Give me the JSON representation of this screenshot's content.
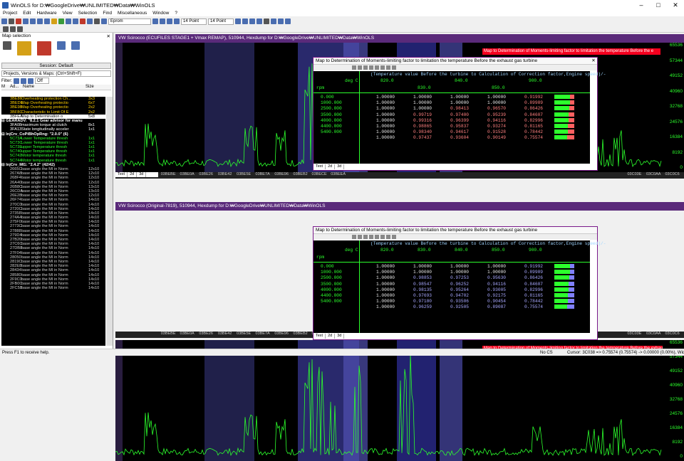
{
  "window": {
    "title": "WinOLS for D:₩GoogleDrive₩UNLIMITED₩Data₩WinOLS"
  },
  "menu": [
    "Project",
    "Edit",
    "Hardware",
    "View",
    "Selection",
    "Find",
    "Miscellaneous",
    "Window",
    "?"
  ],
  "toolbar": {
    "eprom": "Eprom",
    "font1": "14 Point",
    "font2": "14 Point"
  },
  "panel": {
    "title": "Map selection",
    "session": "Session: Default",
    "project_field": "Projects, Versions & Maps: (Ctrl+Shift+F)",
    "filter_label": "Filter:",
    "filter_value": "Off",
    "col_m": "M",
    "col_addr": "Ad...",
    "col_name": "Name",
    "col_size": "Size"
  },
  "maplist": [
    {
      "id": "3BE86",
      "name": "Overheating protection Ch...",
      "size": "3x3",
      "style": "c-yel"
    },
    {
      "id": "3BEDE",
      "name": "Map Overheating protectio",
      "size": "6x7",
      "style": "c-yel"
    },
    {
      "id": "3BE98",
      "name": "Map Overheating protectio",
      "size": "2x2",
      "style": "c-yel"
    },
    {
      "id": "3BF8C",
      "name": "Characteristic to Limit Of E",
      "size": "2x2",
      "style": "c-yel"
    },
    {
      "id": "3BFEA",
      "name": "Map to Determination o",
      "size": "5x8",
      "style": "sel"
    },
    {
      "id": "GEARADV",
      "name": "\"8.2.1     Gear advisor for manu",
      "size": "",
      "style": "grp"
    },
    {
      "id": "3FA08",
      "name": "maximum torque at clutch",
      "size": "8x1",
      "style": "c-wht"
    },
    {
      "id": "3FA13",
      "name": "State longitudinally acceler",
      "size": "1x1",
      "style": "c-wht"
    },
    {
      "id": "InjCrv_CoPiBhOpRng",
      "name": "\"2.0.0\" (6)",
      "size": "",
      "style": "grp"
    },
    {
      "id": "5C73A",
      "name": "Lower Temperature thresh",
      "size": "1x1",
      "style": "c-grn"
    },
    {
      "id": "5C73C",
      "name": "Lower Temperature thresh",
      "size": "1x1",
      "style": "c-grn"
    },
    {
      "id": "5C73E",
      "name": "upper Temperature thresh",
      "size": "1x1",
      "style": "c-grn"
    },
    {
      "id": "5C740",
      "name": "upper Temperature thresh",
      "size": "1x1",
      "style": "c-grn"
    },
    {
      "id": "5C742",
      "name": "Motor temperature thresh",
      "size": "1x1",
      "style": "c-grn"
    },
    {
      "id": "5C744",
      "name": "Motor temperature thresh",
      "size": "1x1",
      "style": "c-grn"
    },
    {
      "id": "InjCrv_MI1",
      "name": "\"2.4.2\" (42/42)",
      "size": "",
      "style": "grp"
    },
    {
      "id": "2665C",
      "name": "base angle the MI in Norm",
      "size": "12x10",
      "style": ""
    },
    {
      "id": "267A8",
      "name": "base angle the MI in Norm",
      "size": "12x10",
      "style": ""
    },
    {
      "id": "268F4",
      "name": "base angle the MI in Norm",
      "size": "12x10",
      "style": ""
    },
    {
      "id": "26A40",
      "name": "base angle the MI in Norm",
      "size": "12x10",
      "style": ""
    },
    {
      "id": "26B8C",
      "name": "base angle the MI in Norm",
      "size": "13x10",
      "style": ""
    },
    {
      "id": "26CDA",
      "name": "base angle the MI in Norm",
      "size": "13x10",
      "style": ""
    },
    {
      "id": "26E28",
      "name": "base angle the MI in Norm",
      "size": "12x10",
      "style": ""
    },
    {
      "id": "26F74",
      "name": "base angle the MI in Norm",
      "size": "14x10",
      "style": ""
    },
    {
      "id": "270C0",
      "name": "base angle the MI in Norm",
      "size": "14x10",
      "style": ""
    },
    {
      "id": "2720C",
      "name": "base angle the MI in Norm",
      "size": "14x10",
      "style": ""
    },
    {
      "id": "27358",
      "name": "base angle the MI in Norm",
      "size": "14x10",
      "style": ""
    },
    {
      "id": "274A4",
      "name": "base angle the MI in Norm",
      "size": "14x10",
      "style": ""
    },
    {
      "id": "275F0",
      "name": "base angle the MI in Norm",
      "size": "14x10",
      "style": ""
    },
    {
      "id": "2773C",
      "name": "base angle the MI in Norm",
      "size": "14x10",
      "style": ""
    },
    {
      "id": "27888",
      "name": "base angle the MI in Norm",
      "size": "14x10",
      "style": ""
    },
    {
      "id": "279D4",
      "name": "base angle the MI in Norm",
      "size": "14x10",
      "style": ""
    },
    {
      "id": "27B20",
      "name": "base angle the MI in Norm",
      "size": "14x10",
      "style": ""
    },
    {
      "id": "27C6C",
      "name": "base angle the MI in Norm",
      "size": "14x10",
      "style": ""
    },
    {
      "id": "27DB8",
      "name": "base angle the MI in Norm",
      "size": "14x10",
      "style": ""
    },
    {
      "id": "27F04",
      "name": "base angle the MI in Norm",
      "size": "14x10",
      "style": ""
    },
    {
      "id": "28050",
      "name": "base angle the MI in Norm",
      "size": "14x10",
      "style": ""
    },
    {
      "id": "2819C",
      "name": "base angle the MI in Norm",
      "size": "14x10",
      "style": ""
    },
    {
      "id": "282E8",
      "name": "base angle the MI in Norm",
      "size": "14x10",
      "style": ""
    },
    {
      "id": "28434",
      "name": "base angle the MI in Norm",
      "size": "14x10",
      "style": ""
    },
    {
      "id": "28580",
      "name": "base angle the MI in Norm",
      "size": "14x10",
      "style": ""
    },
    {
      "id": "2F9C0",
      "name": "base angle the MI in Norm",
      "size": "14x10",
      "style": ""
    },
    {
      "id": "2FB0C",
      "name": "base angle the MI in Norm",
      "size": "14x10",
      "style": ""
    },
    {
      "id": "2FC58",
      "name": "base angle the MI in Norm",
      "size": "14x10",
      "style": ""
    }
  ],
  "pane_top": {
    "title": "VW Scirocco (ECUFILES STAGE1 + Vmax REMAP), 510944, Hexdump for D:₩GoogleDrive₩UNLIMITED₩Data₩WinOLS",
    "banner": "Map to Determination of Moments-limiting factor to limitation the temperature Before the e",
    "addresses": [
      "03BEBE",
      "03BE0A",
      "03BE26",
      "03BE42",
      "03BE5E",
      "03BE7A",
      "03BE96",
      "03BEB2",
      "03BECE",
      "03BEEA"
    ],
    "right_addresses": [
      "03C03E",
      "03C0AA",
      "03C0C6"
    ],
    "right_axis": [
      "65536",
      "57344",
      "49152",
      "40960",
      "32768",
      "24576",
      "16384",
      "8192",
      "0"
    ],
    "tabs": [
      "Text",
      "2d",
      "3d"
    ]
  },
  "pane_bottom": {
    "title": "VW Scirocco (Original-7819), 510944, Hexdump for D:₩GoogleDrive₩UNLIMITED₩Data₩WinOLS",
    "banner": "Map to Determination of Moments-limiting factor to limitation the temperature Before the exhaust gas turbine",
    "addresses": [
      "03BEBE",
      "03BE0A",
      "03BE26",
      "03BE42",
      "03BE5E",
      "03BE7A",
      "03BE96",
      "03BEB2",
      "03BECE",
      "03BEEA"
    ],
    "right_addresses": [
      "03C03E",
      "03C0AA",
      "03C0C6"
    ],
    "right_axis": [
      "65536",
      "57344",
      "49152",
      "40960",
      "32768",
      "24576",
      "16384",
      "8192",
      "0"
    ],
    "tabs": [
      "Text",
      "2d",
      "3d"
    ]
  },
  "map_top": {
    "title": "Map to Determination of Moments-limiting factor to limitation the temperature Before the exhaust gas turbine",
    "header": "(Temperature value Before the turbine to Calculation of Correction factor,Engine speed)/-",
    "unit_x": "deg C",
    "unit_y": "rpm",
    "cols_a": [
      "820.0",
      "840.0",
      "900.0"
    ],
    "cols_b": [
      "830.0",
      "850.0"
    ],
    "rows": [
      "0.000",
      "1000.000",
      "2500.000",
      "3500.000",
      "4000.000",
      "4400.000",
      "5400.000"
    ],
    "data": [
      [
        "1.00000",
        "1.00000",
        "1.00000",
        "1.00000",
        "0.91992"
      ],
      [
        "1.00000",
        "1.00000",
        "1.00000",
        "1.00000",
        "0.89989"
      ],
      [
        "1.00000",
        "1.00000",
        "0.98413",
        "0.96570",
        "0.86426"
      ],
      [
        "1.00000",
        "0.99719",
        "0.97400",
        "0.95239",
        "0.84607"
      ],
      [
        "1.00000",
        "0.99316",
        "0.96399",
        "0.94116",
        "0.82996"
      ],
      [
        "1.00000",
        "0.98865",
        "0.95837",
        "0.93274",
        "0.81165"
      ],
      [
        "1.00000",
        "0.98340",
        "0.94617",
        "0.91528",
        "0.78442"
      ],
      [
        "1.00000",
        "0.97437",
        "0.93604",
        "0.90149",
        "0.75574"
      ]
    ],
    "rows_full": [
      "0.000",
      "1000.000",
      "2500.000",
      "3500.000",
      "4000.000",
      "4400.000",
      "5400.000"
    ],
    "tabs": [
      "Text",
      "2d",
      "3d"
    ]
  },
  "map_bottom": {
    "title": "Map to Determination of Moments-limiting factor to limitation the temperature Before the exhaust gas turbine",
    "header": "(Temperature value Before the turbine to Calculation of Correction factor,Engine speed)/-",
    "unit_x": "deg C",
    "unit_y": "rpm",
    "cols": [
      "820.0",
      "830.0",
      "840.0",
      "850.0",
      "900.0"
    ],
    "rows": [
      "0.000",
      "1000.000",
      "2500.000",
      "3500.000",
      "4000.000",
      "4400.000",
      "5400.000"
    ],
    "data": [
      [
        "1.00000",
        "1.00000",
        "1.00000",
        "1.00000",
        "0.91992"
      ],
      [
        "1.00000",
        "1.00000",
        "1.00000",
        "1.00000",
        "0.89989"
      ],
      [
        "1.00000",
        "0.98853",
        "0.97253",
        "0.95630",
        "0.86426"
      ],
      [
        "1.00000",
        "0.98547",
        "0.96252",
        "0.94116",
        "0.84607"
      ],
      [
        "1.00000",
        "0.98135",
        "0.95264",
        "0.93005",
        "0.82996"
      ],
      [
        "1.00000",
        "0.97693",
        "0.94702",
        "0.92175",
        "0.81165"
      ],
      [
        "1.00000",
        "0.97180",
        "0.93506",
        "0.90454",
        "0.78442"
      ],
      [
        "1.00000",
        "0.96259",
        "0.92505",
        "0.89087",
        "0.75574"
      ]
    ],
    "tabs": [
      "Text",
      "2d",
      "3d"
    ]
  },
  "status": {
    "help": "Press F1 to receive help.",
    "no_cs": "No CS",
    "cursor": "Cursor: 3C038 => 0.75574 (0.75574) -> 0.00000 (0.00%), Width: 8"
  }
}
